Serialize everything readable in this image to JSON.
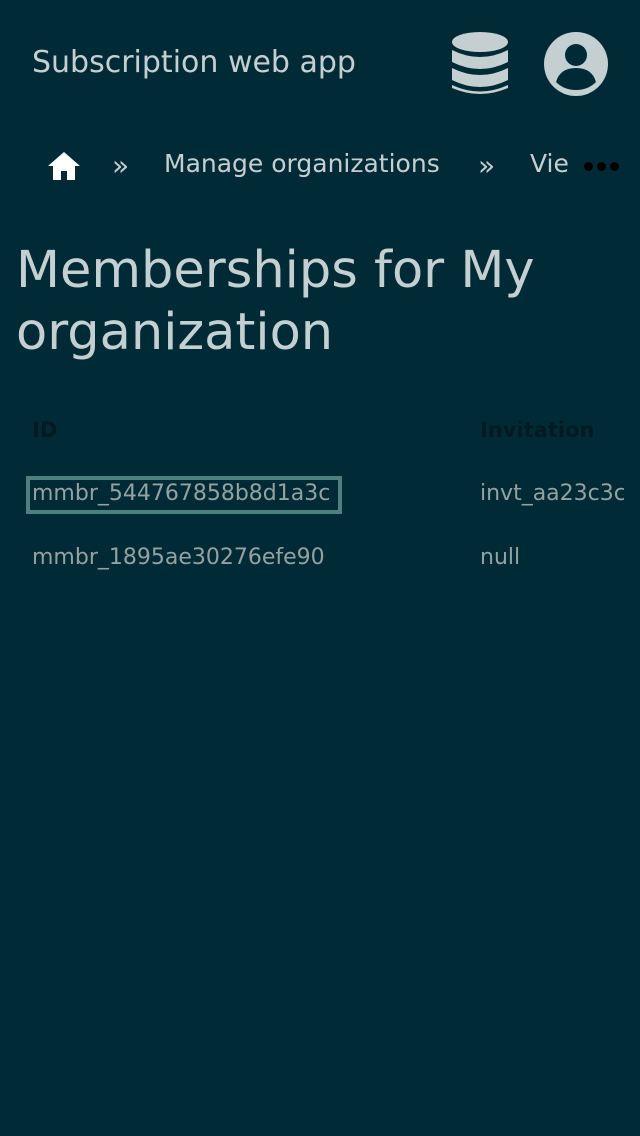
{
  "header": {
    "title": "Subscription web app",
    "icons": [
      "database-icon",
      "user-account-icon"
    ]
  },
  "breadcrumb": {
    "home_icon": "home-icon",
    "separator": "»",
    "items": [
      {
        "label": "Manage organizations"
      },
      {
        "label": "Vie"
      }
    ],
    "more_icon": "ellipsis-icon"
  },
  "page": {
    "title": "Memberships for My organization"
  },
  "table": {
    "columns": [
      "ID",
      "Invitation"
    ],
    "rows": [
      {
        "id": "mmbr_544767858b8d1a3c",
        "invitation": "invt_aa23c3c",
        "focused": true
      },
      {
        "id": "mmbr_1895ae30276efe90",
        "invitation": "null",
        "focused": false
      }
    ]
  },
  "colors": {
    "background": "#002b36",
    "text": "#c4cfd1",
    "cell_text": "#93a1a1",
    "focus": "#4c8180"
  }
}
